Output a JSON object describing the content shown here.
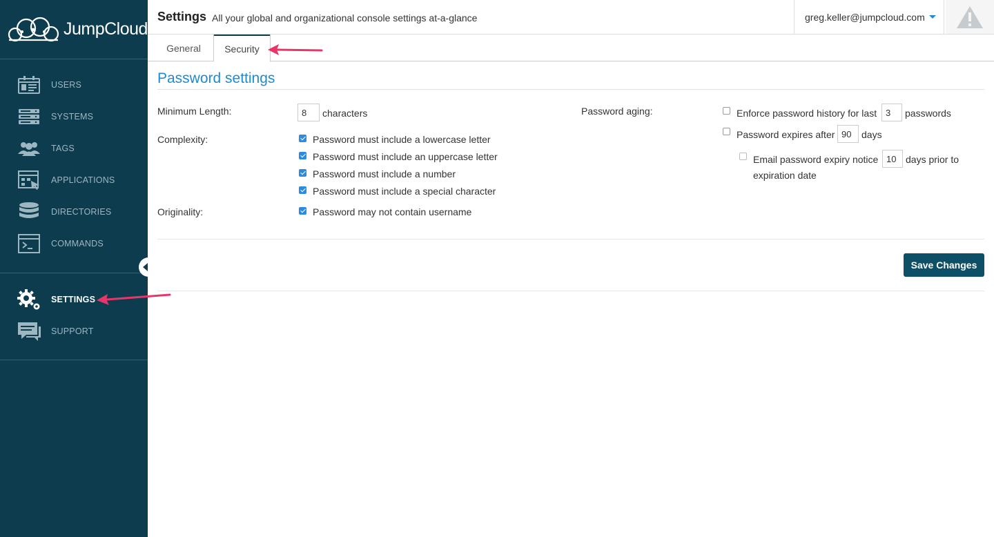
{
  "brand": {
    "name": "JumpCloud"
  },
  "sidebar": {
    "items": [
      {
        "label": "USERS",
        "icon": "users-icon"
      },
      {
        "label": "SYSTEMS",
        "icon": "systems-icon"
      },
      {
        "label": "TAGS",
        "icon": "tags-icon"
      },
      {
        "label": "APPLICATIONS",
        "icon": "applications-icon"
      },
      {
        "label": "DIRECTORIES",
        "icon": "directories-icon"
      },
      {
        "label": "COMMANDS",
        "icon": "commands-icon"
      }
    ],
    "secondary": [
      {
        "label": "SETTINGS",
        "icon": "settings-gear-icon",
        "active": true
      },
      {
        "label": "SUPPORT",
        "icon": "support-chat-icon"
      }
    ]
  },
  "header": {
    "title": "Settings",
    "subtitle": "All your global and organizational console settings at-a-glance",
    "user_email": "greg.keller@jumpcloud.com"
  },
  "tabs": [
    {
      "label": "General",
      "active": false
    },
    {
      "label": "Security",
      "active": true
    }
  ],
  "password_settings": {
    "title": "Password settings",
    "min_length": {
      "label": "Minimum Length:",
      "value": "8",
      "unit": "characters"
    },
    "complexity": {
      "label": "Complexity:",
      "options": [
        {
          "label": "Password must include a lowercase letter",
          "checked": true
        },
        {
          "label": "Password must include an uppercase letter",
          "checked": true
        },
        {
          "label": "Password must include a number",
          "checked": true
        },
        {
          "label": "Password must include a special character",
          "checked": true
        }
      ]
    },
    "originality": {
      "label": "Originality:",
      "options": [
        {
          "label": "Password may not contain username",
          "checked": true
        }
      ]
    },
    "aging": {
      "label": "Password aging:",
      "history": {
        "prefix": "Enforce password history for last",
        "value": "3",
        "suffix": "passwords",
        "checked": false
      },
      "expires": {
        "prefix": "Password expires after",
        "value": "90",
        "suffix": "days",
        "checked": false
      },
      "notice": {
        "prefix": "Email password expiry notice",
        "value": "10",
        "suffix": "days prior to",
        "suffix_line2": "expiration date",
        "checked": false
      }
    },
    "save_label": "Save Changes"
  },
  "colors": {
    "sidebar_bg": "#0d3c4f",
    "accent": "#1d8bd1",
    "button_bg": "#0d4f66",
    "checkbox": "#2c8be0",
    "annotation_arrow": "#e8366b"
  }
}
